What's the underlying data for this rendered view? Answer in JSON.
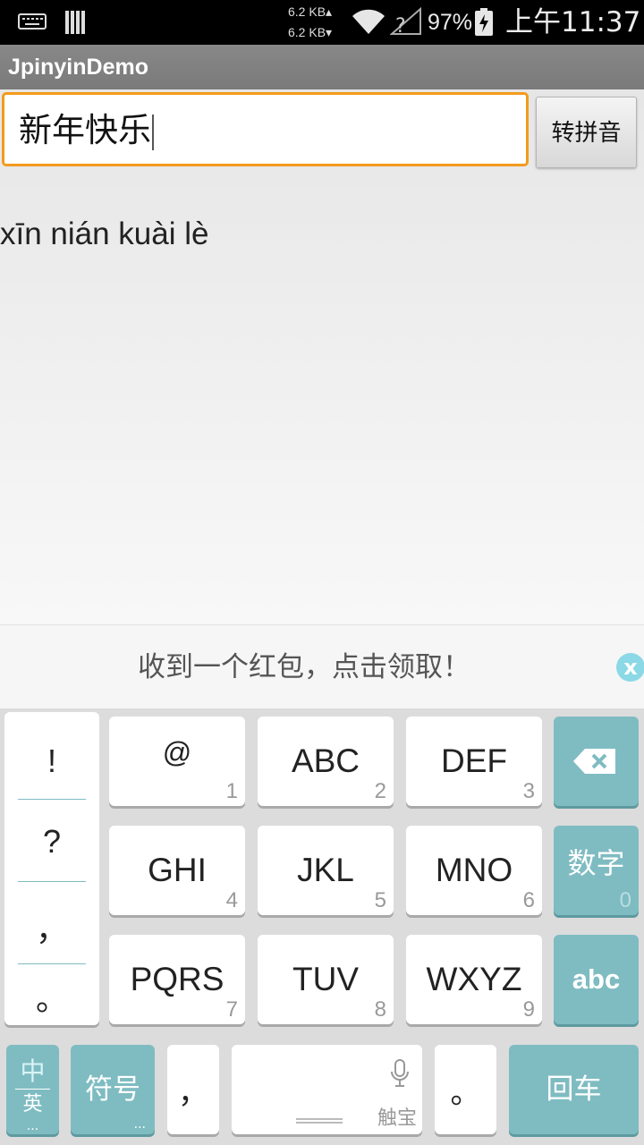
{
  "status_bar": {
    "speed_up": "6.2 KB▴",
    "speed_down": "6.2 KB▾",
    "battery": "97%",
    "time": "上午11:37",
    "icons": [
      "keyboard-icon",
      "sim-icon",
      "wifi-icon",
      "no-signal-icon",
      "battery-charging-icon"
    ]
  },
  "app": {
    "title": "JpinyinDemo"
  },
  "input": {
    "value": "新年快乐"
  },
  "convert_button": {
    "label": "转拼音"
  },
  "result": {
    "text": "xīn nián kuài lè"
  },
  "banner": {
    "message": "收到一个红包，点击领取！",
    "close_label": "x"
  },
  "keyboard": {
    "symbols": [
      "!",
      "?",
      "，",
      "。"
    ],
    "keys": [
      {
        "main": "@",
        "num": "1"
      },
      {
        "main": "ABC",
        "num": "2"
      },
      {
        "main": "DEF",
        "num": "3"
      },
      {
        "main": "GHI",
        "num": "4"
      },
      {
        "main": "JKL",
        "num": "5"
      },
      {
        "main": "MNO",
        "num": "6"
      },
      {
        "main": "PQRS",
        "num": "7"
      },
      {
        "main": "TUV",
        "num": "8"
      },
      {
        "main": "WXYZ",
        "num": "9"
      }
    ],
    "digits_key": {
      "label": "数字",
      "num": "0"
    },
    "abc_key": {
      "label": "abc"
    },
    "lang_key": {
      "top": "中",
      "bottom": "英",
      "dots": "..."
    },
    "symbols_key": {
      "label": "符号",
      "dots": "..."
    },
    "comma_key": {
      "label": "，"
    },
    "space_key": {
      "label": "触宝"
    },
    "period_key": {
      "label": "。"
    },
    "enter_key": {
      "label": "回车"
    },
    "colors": {
      "accent": "#7fbcc2",
      "focus": "#f39a1d"
    }
  }
}
